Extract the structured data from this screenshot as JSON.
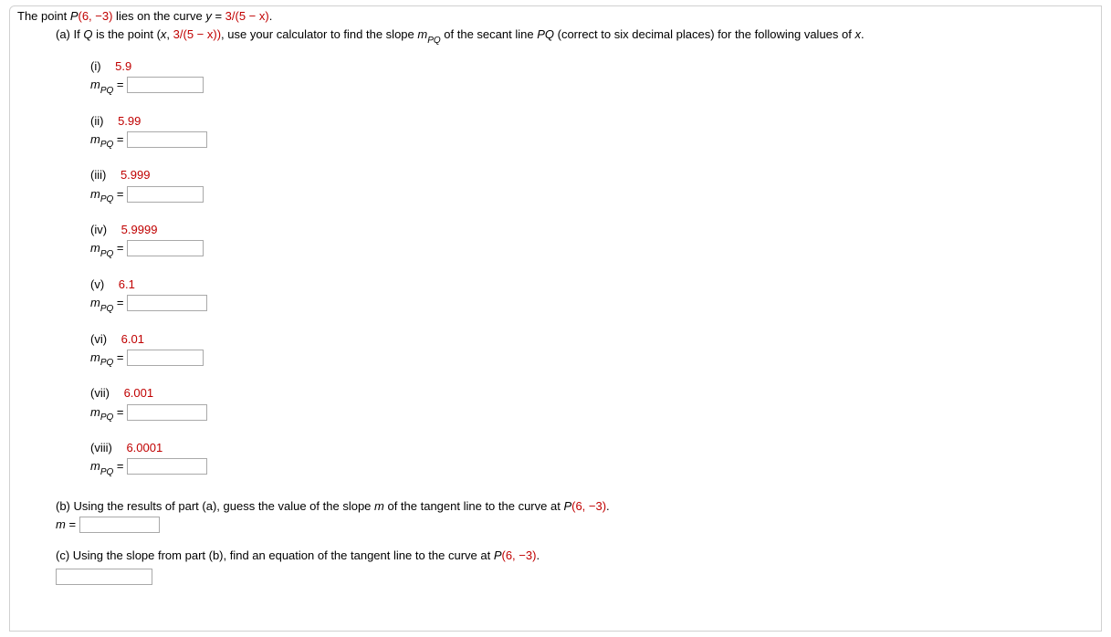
{
  "intro": {
    "prefix": "The point  ",
    "point": "P",
    "coords": "(6, −3)",
    "mid": "  lies on the curve  ",
    "curve_lhs": "y",
    "eq": " = ",
    "curve_rhs": "3/(5 − x)",
    "suffix": "."
  },
  "partA": {
    "label": "(a) If ",
    "q": "Q",
    "mid1": " is the point  ",
    "qpoint_open": "(x, ",
    "qpoint_expr": "3/(5 − x))",
    "mid2": ",  use your calculator to find the slope  ",
    "m": "m",
    "pq": "PQ",
    "mid3": "  of the secant line ",
    "secant": "PQ",
    "mid4": " (correct to six decimal places) for the following values of ",
    "x": "x",
    "end": "."
  },
  "items": [
    {
      "roman": "(i)",
      "val": "5.9"
    },
    {
      "roman": "(ii)",
      "val": "5.99"
    },
    {
      "roman": "(iii)",
      "val": "5.999"
    },
    {
      "roman": "(iv)",
      "val": "5.9999"
    },
    {
      "roman": "(v)",
      "val": "6.1"
    },
    {
      "roman": "(vi)",
      "val": "6.01"
    },
    {
      "roman": "(vii)",
      "val": "6.001"
    },
    {
      "roman": "(viii)",
      "val": "6.0001"
    }
  ],
  "mlabel": {
    "m": "m",
    "pq": "PQ",
    "eq": " = "
  },
  "partB": {
    "text1": "(b) Using the results of part (a), guess the value of the slope ",
    "m": "m",
    "text2": " of the tangent line to the curve at  ",
    "p": "P",
    "coords": "(6, −3)",
    "end": ".",
    "ml": "m",
    "eq": " = "
  },
  "partC": {
    "text1": "(c) Using the slope from part (b), find an equation of the tangent line to the curve at  ",
    "p": "P",
    "coords": "(6, −3)",
    "end": "."
  }
}
